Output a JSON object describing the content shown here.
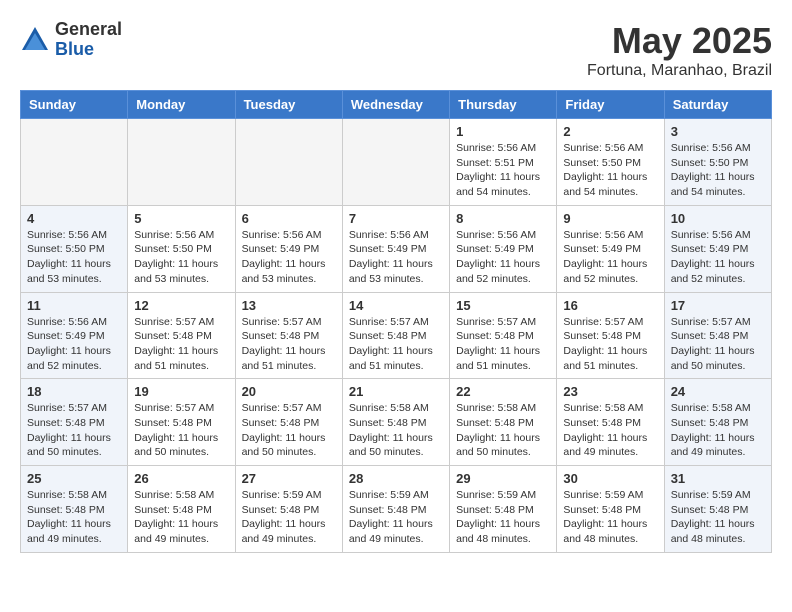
{
  "header": {
    "logo_general": "General",
    "logo_blue": "Blue",
    "month_title": "May 2025",
    "location": "Fortuna, Maranhao, Brazil"
  },
  "days_of_week": [
    "Sunday",
    "Monday",
    "Tuesday",
    "Wednesday",
    "Thursday",
    "Friday",
    "Saturday"
  ],
  "weeks": [
    [
      {
        "day": "",
        "info": ""
      },
      {
        "day": "",
        "info": ""
      },
      {
        "day": "",
        "info": ""
      },
      {
        "day": "",
        "info": ""
      },
      {
        "day": "1",
        "info": "Sunrise: 5:56 AM\nSunset: 5:51 PM\nDaylight: 11 hours\nand 54 minutes."
      },
      {
        "day": "2",
        "info": "Sunrise: 5:56 AM\nSunset: 5:50 PM\nDaylight: 11 hours\nand 54 minutes."
      },
      {
        "day": "3",
        "info": "Sunrise: 5:56 AM\nSunset: 5:50 PM\nDaylight: 11 hours\nand 54 minutes."
      }
    ],
    [
      {
        "day": "4",
        "info": "Sunrise: 5:56 AM\nSunset: 5:50 PM\nDaylight: 11 hours\nand 53 minutes."
      },
      {
        "day": "5",
        "info": "Sunrise: 5:56 AM\nSunset: 5:50 PM\nDaylight: 11 hours\nand 53 minutes."
      },
      {
        "day": "6",
        "info": "Sunrise: 5:56 AM\nSunset: 5:49 PM\nDaylight: 11 hours\nand 53 minutes."
      },
      {
        "day": "7",
        "info": "Sunrise: 5:56 AM\nSunset: 5:49 PM\nDaylight: 11 hours\nand 53 minutes."
      },
      {
        "day": "8",
        "info": "Sunrise: 5:56 AM\nSunset: 5:49 PM\nDaylight: 11 hours\nand 52 minutes."
      },
      {
        "day": "9",
        "info": "Sunrise: 5:56 AM\nSunset: 5:49 PM\nDaylight: 11 hours\nand 52 minutes."
      },
      {
        "day": "10",
        "info": "Sunrise: 5:56 AM\nSunset: 5:49 PM\nDaylight: 11 hours\nand 52 minutes."
      }
    ],
    [
      {
        "day": "11",
        "info": "Sunrise: 5:56 AM\nSunset: 5:49 PM\nDaylight: 11 hours\nand 52 minutes."
      },
      {
        "day": "12",
        "info": "Sunrise: 5:57 AM\nSunset: 5:48 PM\nDaylight: 11 hours\nand 51 minutes."
      },
      {
        "day": "13",
        "info": "Sunrise: 5:57 AM\nSunset: 5:48 PM\nDaylight: 11 hours\nand 51 minutes."
      },
      {
        "day": "14",
        "info": "Sunrise: 5:57 AM\nSunset: 5:48 PM\nDaylight: 11 hours\nand 51 minutes."
      },
      {
        "day": "15",
        "info": "Sunrise: 5:57 AM\nSunset: 5:48 PM\nDaylight: 11 hours\nand 51 minutes."
      },
      {
        "day": "16",
        "info": "Sunrise: 5:57 AM\nSunset: 5:48 PM\nDaylight: 11 hours\nand 51 minutes."
      },
      {
        "day": "17",
        "info": "Sunrise: 5:57 AM\nSunset: 5:48 PM\nDaylight: 11 hours\nand 50 minutes."
      }
    ],
    [
      {
        "day": "18",
        "info": "Sunrise: 5:57 AM\nSunset: 5:48 PM\nDaylight: 11 hours\nand 50 minutes."
      },
      {
        "day": "19",
        "info": "Sunrise: 5:57 AM\nSunset: 5:48 PM\nDaylight: 11 hours\nand 50 minutes."
      },
      {
        "day": "20",
        "info": "Sunrise: 5:57 AM\nSunset: 5:48 PM\nDaylight: 11 hours\nand 50 minutes."
      },
      {
        "day": "21",
        "info": "Sunrise: 5:58 AM\nSunset: 5:48 PM\nDaylight: 11 hours\nand 50 minutes."
      },
      {
        "day": "22",
        "info": "Sunrise: 5:58 AM\nSunset: 5:48 PM\nDaylight: 11 hours\nand 50 minutes."
      },
      {
        "day": "23",
        "info": "Sunrise: 5:58 AM\nSunset: 5:48 PM\nDaylight: 11 hours\nand 49 minutes."
      },
      {
        "day": "24",
        "info": "Sunrise: 5:58 AM\nSunset: 5:48 PM\nDaylight: 11 hours\nand 49 minutes."
      }
    ],
    [
      {
        "day": "25",
        "info": "Sunrise: 5:58 AM\nSunset: 5:48 PM\nDaylight: 11 hours\nand 49 minutes."
      },
      {
        "day": "26",
        "info": "Sunrise: 5:58 AM\nSunset: 5:48 PM\nDaylight: 11 hours\nand 49 minutes."
      },
      {
        "day": "27",
        "info": "Sunrise: 5:59 AM\nSunset: 5:48 PM\nDaylight: 11 hours\nand 49 minutes."
      },
      {
        "day": "28",
        "info": "Sunrise: 5:59 AM\nSunset: 5:48 PM\nDaylight: 11 hours\nand 49 minutes."
      },
      {
        "day": "29",
        "info": "Sunrise: 5:59 AM\nSunset: 5:48 PM\nDaylight: 11 hours\nand 48 minutes."
      },
      {
        "day": "30",
        "info": "Sunrise: 5:59 AM\nSunset: 5:48 PM\nDaylight: 11 hours\nand 48 minutes."
      },
      {
        "day": "31",
        "info": "Sunrise: 5:59 AM\nSunset: 5:48 PM\nDaylight: 11 hours\nand 48 minutes."
      }
    ]
  ]
}
